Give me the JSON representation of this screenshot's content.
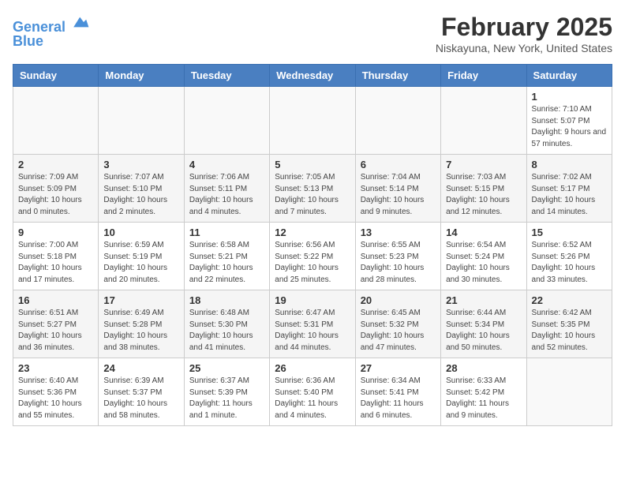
{
  "header": {
    "logo_line1": "General",
    "logo_line2": "Blue",
    "title": "February 2025",
    "subtitle": "Niskayuna, New York, United States"
  },
  "columns": [
    "Sunday",
    "Monday",
    "Tuesday",
    "Wednesday",
    "Thursday",
    "Friday",
    "Saturday"
  ],
  "weeks": [
    [
      {
        "day": "",
        "info": ""
      },
      {
        "day": "",
        "info": ""
      },
      {
        "day": "",
        "info": ""
      },
      {
        "day": "",
        "info": ""
      },
      {
        "day": "",
        "info": ""
      },
      {
        "day": "",
        "info": ""
      },
      {
        "day": "1",
        "info": "Sunrise: 7:10 AM\nSunset: 5:07 PM\nDaylight: 9 hours and 57 minutes."
      }
    ],
    [
      {
        "day": "2",
        "info": "Sunrise: 7:09 AM\nSunset: 5:09 PM\nDaylight: 10 hours and 0 minutes."
      },
      {
        "day": "3",
        "info": "Sunrise: 7:07 AM\nSunset: 5:10 PM\nDaylight: 10 hours and 2 minutes."
      },
      {
        "day": "4",
        "info": "Sunrise: 7:06 AM\nSunset: 5:11 PM\nDaylight: 10 hours and 4 minutes."
      },
      {
        "day": "5",
        "info": "Sunrise: 7:05 AM\nSunset: 5:13 PM\nDaylight: 10 hours and 7 minutes."
      },
      {
        "day": "6",
        "info": "Sunrise: 7:04 AM\nSunset: 5:14 PM\nDaylight: 10 hours and 9 minutes."
      },
      {
        "day": "7",
        "info": "Sunrise: 7:03 AM\nSunset: 5:15 PM\nDaylight: 10 hours and 12 minutes."
      },
      {
        "day": "8",
        "info": "Sunrise: 7:02 AM\nSunset: 5:17 PM\nDaylight: 10 hours and 14 minutes."
      }
    ],
    [
      {
        "day": "9",
        "info": "Sunrise: 7:00 AM\nSunset: 5:18 PM\nDaylight: 10 hours and 17 minutes."
      },
      {
        "day": "10",
        "info": "Sunrise: 6:59 AM\nSunset: 5:19 PM\nDaylight: 10 hours and 20 minutes."
      },
      {
        "day": "11",
        "info": "Sunrise: 6:58 AM\nSunset: 5:21 PM\nDaylight: 10 hours and 22 minutes."
      },
      {
        "day": "12",
        "info": "Sunrise: 6:56 AM\nSunset: 5:22 PM\nDaylight: 10 hours and 25 minutes."
      },
      {
        "day": "13",
        "info": "Sunrise: 6:55 AM\nSunset: 5:23 PM\nDaylight: 10 hours and 28 minutes."
      },
      {
        "day": "14",
        "info": "Sunrise: 6:54 AM\nSunset: 5:24 PM\nDaylight: 10 hours and 30 minutes."
      },
      {
        "day": "15",
        "info": "Sunrise: 6:52 AM\nSunset: 5:26 PM\nDaylight: 10 hours and 33 minutes."
      }
    ],
    [
      {
        "day": "16",
        "info": "Sunrise: 6:51 AM\nSunset: 5:27 PM\nDaylight: 10 hours and 36 minutes."
      },
      {
        "day": "17",
        "info": "Sunrise: 6:49 AM\nSunset: 5:28 PM\nDaylight: 10 hours and 38 minutes."
      },
      {
        "day": "18",
        "info": "Sunrise: 6:48 AM\nSunset: 5:30 PM\nDaylight: 10 hours and 41 minutes."
      },
      {
        "day": "19",
        "info": "Sunrise: 6:47 AM\nSunset: 5:31 PM\nDaylight: 10 hours and 44 minutes."
      },
      {
        "day": "20",
        "info": "Sunrise: 6:45 AM\nSunset: 5:32 PM\nDaylight: 10 hours and 47 minutes."
      },
      {
        "day": "21",
        "info": "Sunrise: 6:44 AM\nSunset: 5:34 PM\nDaylight: 10 hours and 50 minutes."
      },
      {
        "day": "22",
        "info": "Sunrise: 6:42 AM\nSunset: 5:35 PM\nDaylight: 10 hours and 52 minutes."
      }
    ],
    [
      {
        "day": "23",
        "info": "Sunrise: 6:40 AM\nSunset: 5:36 PM\nDaylight: 10 hours and 55 minutes."
      },
      {
        "day": "24",
        "info": "Sunrise: 6:39 AM\nSunset: 5:37 PM\nDaylight: 10 hours and 58 minutes."
      },
      {
        "day": "25",
        "info": "Sunrise: 6:37 AM\nSunset: 5:39 PM\nDaylight: 11 hours and 1 minute."
      },
      {
        "day": "26",
        "info": "Sunrise: 6:36 AM\nSunset: 5:40 PM\nDaylight: 11 hours and 4 minutes."
      },
      {
        "day": "27",
        "info": "Sunrise: 6:34 AM\nSunset: 5:41 PM\nDaylight: 11 hours and 6 minutes."
      },
      {
        "day": "28",
        "info": "Sunrise: 6:33 AM\nSunset: 5:42 PM\nDaylight: 11 hours and 9 minutes."
      },
      {
        "day": "",
        "info": ""
      }
    ]
  ]
}
